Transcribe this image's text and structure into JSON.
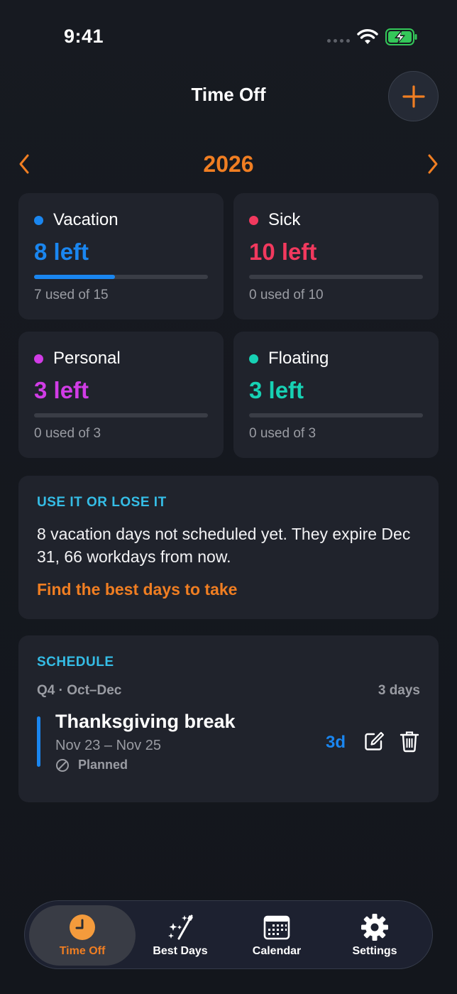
{
  "status_bar": {
    "time": "9:41"
  },
  "header": {
    "title": "Time Off"
  },
  "year_nav": {
    "year": "2026"
  },
  "balances": [
    {
      "name": "Vacation",
      "left_text": "8 left",
      "used_text": "7 used of 15",
      "used": 7,
      "total": 15,
      "color": "#1a86f0"
    },
    {
      "name": "Sick",
      "left_text": "10 left",
      "used_text": "0 used of 10",
      "used": 0,
      "total": 10,
      "color": "#f2395e"
    },
    {
      "name": "Personal",
      "left_text": "3 left",
      "used_text": "0 used of 3",
      "used": 0,
      "total": 3,
      "color": "#d13ce6"
    },
    {
      "name": "Floating",
      "left_text": "3 left",
      "used_text": "0 used of 3",
      "used": 0,
      "total": 3,
      "color": "#17d1b4"
    }
  ],
  "use_it": {
    "heading": "USE IT OR LOSE IT",
    "message": "8 vacation days not scheduled yet. They expire Dec 31, 66 workdays from now.",
    "link": "Find the best days to take"
  },
  "schedule": {
    "heading": "SCHEDULE",
    "quarter": "Q4 · Oct–Dec",
    "quarter_total": "3 days",
    "entries": [
      {
        "title": "Thanksgiving break",
        "dates": "Nov 23 – Nov 25",
        "status": "Planned",
        "days": "3d",
        "color": "#1a86f0"
      }
    ]
  },
  "tabs": [
    {
      "label": "Time Off",
      "icon": "clock-icon",
      "active": true
    },
    {
      "label": "Best Days",
      "icon": "magic-wand-icon",
      "active": false
    },
    {
      "label": "Calendar",
      "icon": "calendar-icon",
      "active": false
    },
    {
      "label": "Settings",
      "icon": "gear-icon",
      "active": false
    }
  ],
  "colors": {
    "accent": "#f07e22",
    "section_heading": "#35bde6",
    "card_bg": "#20232c",
    "battery": "#34c759"
  }
}
